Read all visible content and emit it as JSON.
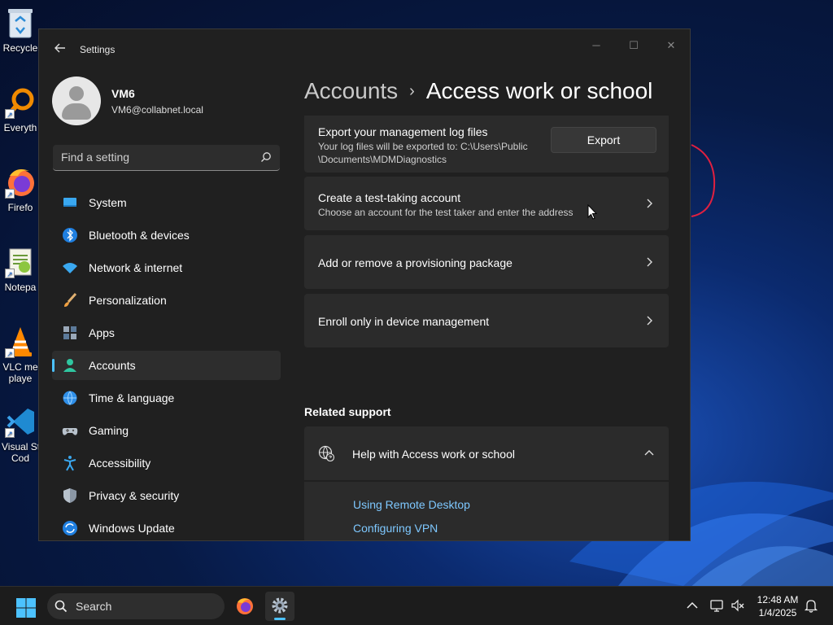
{
  "desktop": {
    "icons": [
      {
        "label": "Recycle"
      },
      {
        "label": "Everyth"
      },
      {
        "label": "Firefo"
      },
      {
        "label": "Notepa"
      },
      {
        "label": "VLC me"
      },
      {
        "label": "playe"
      },
      {
        "label": "Visual St"
      },
      {
        "label": "Cod"
      }
    ]
  },
  "window": {
    "title": "Settings",
    "controls": {
      "minimize": "─",
      "maximize": "☐",
      "close": "✕"
    }
  },
  "profile": {
    "name": "VM6",
    "email": "VM6@collabnet.local"
  },
  "search": {
    "placeholder": "Find a setting"
  },
  "nav": {
    "items": [
      {
        "label": "System",
        "icon": "system-icon"
      },
      {
        "label": "Bluetooth & devices",
        "icon": "bluetooth-icon"
      },
      {
        "label": "Network & internet",
        "icon": "wifi-icon"
      },
      {
        "label": "Personalization",
        "icon": "brush-icon"
      },
      {
        "label": "Apps",
        "icon": "apps-icon"
      },
      {
        "label": "Accounts",
        "icon": "person-icon",
        "active": true
      },
      {
        "label": "Time & language",
        "icon": "globe-clock-icon"
      },
      {
        "label": "Gaming",
        "icon": "gamepad-icon"
      },
      {
        "label": "Accessibility",
        "icon": "accessibility-icon"
      },
      {
        "label": "Privacy & security",
        "icon": "shield-icon"
      },
      {
        "label": "Windows Update",
        "icon": "update-icon"
      }
    ]
  },
  "breadcrumb": {
    "parent": "Accounts",
    "separator": "›",
    "current": "Access work or school"
  },
  "cards": {
    "export": {
      "title": "Export your management log files",
      "desc_line1": "Your log files will be exported to: C:\\Users\\Public",
      "desc_line2": "\\Documents\\MDMDiagnostics",
      "button": "Export"
    },
    "test_account": {
      "title": "Create a test-taking account",
      "desc": "Choose an account for the test taker and enter the address"
    },
    "provisioning": {
      "title": "Add or remove a provisioning package"
    },
    "enroll": {
      "title": "Enroll only in device management"
    }
  },
  "related_support": {
    "heading": "Related support",
    "help_title": "Help with Access work or school",
    "links": [
      "Using Remote Desktop",
      "Configuring VPN"
    ]
  },
  "taskbar": {
    "search_label": "Search",
    "time": "12:48 AM",
    "date": "1/4/2025"
  },
  "colors": {
    "accent": "#4cc2ff",
    "link": "#7ec8ff",
    "window_bg": "#202020",
    "card_bg": "#2b2b2b"
  }
}
